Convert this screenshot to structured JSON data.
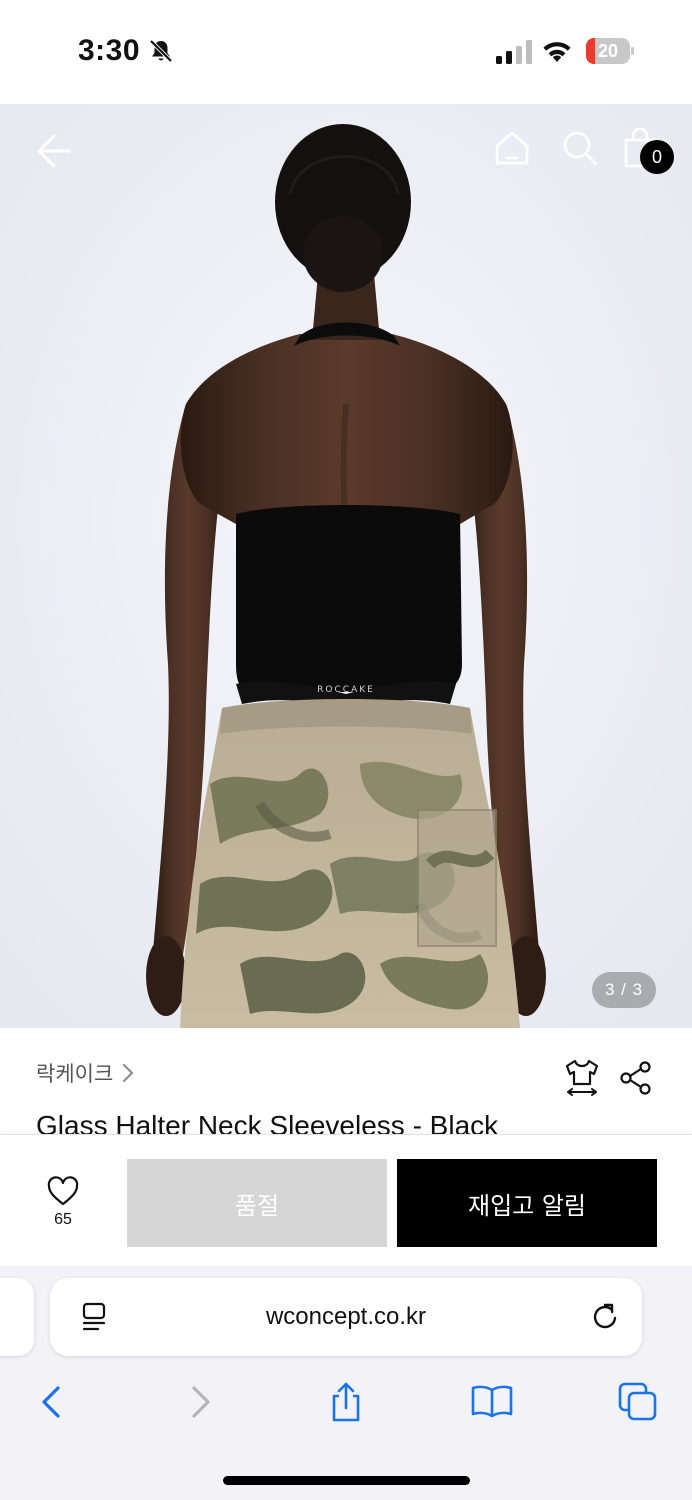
{
  "status_bar": {
    "time": "3:30",
    "battery_level": "20",
    "battery_fraction": 0.2,
    "icons": [
      "bell-slash-icon",
      "cellular-signal-icon",
      "wifi-icon",
      "battery-icon"
    ]
  },
  "header": {
    "cart_count": "0",
    "icons": [
      "back-arrow-icon",
      "home-icon",
      "search-icon",
      "shopping-bag-icon"
    ]
  },
  "gallery": {
    "counter": "3 / 3",
    "image": {
      "subject": "model back view",
      "waistband_text": "ROCCAKE"
    }
  },
  "product": {
    "brand": "락케이크",
    "title": "Glass Halter Neck Sleeveless - Black",
    "icons": [
      "size-guide-icon",
      "share-icon"
    ]
  },
  "actions": {
    "like_count": "65",
    "soldout_label": "품절",
    "restock_label": "재입고 알림"
  },
  "browser": {
    "url": "wconcept.co.kr",
    "icons": [
      "reader-icon",
      "reload-icon",
      "back-icon",
      "forward-icon",
      "share-icon",
      "bookmarks-icon",
      "tabs-icon"
    ]
  },
  "colors": {
    "primary_button": "#000000",
    "disabled_button": "#d6d6d6",
    "browser_tint": "#1a73e8",
    "battery_low": "#eb3b30"
  }
}
